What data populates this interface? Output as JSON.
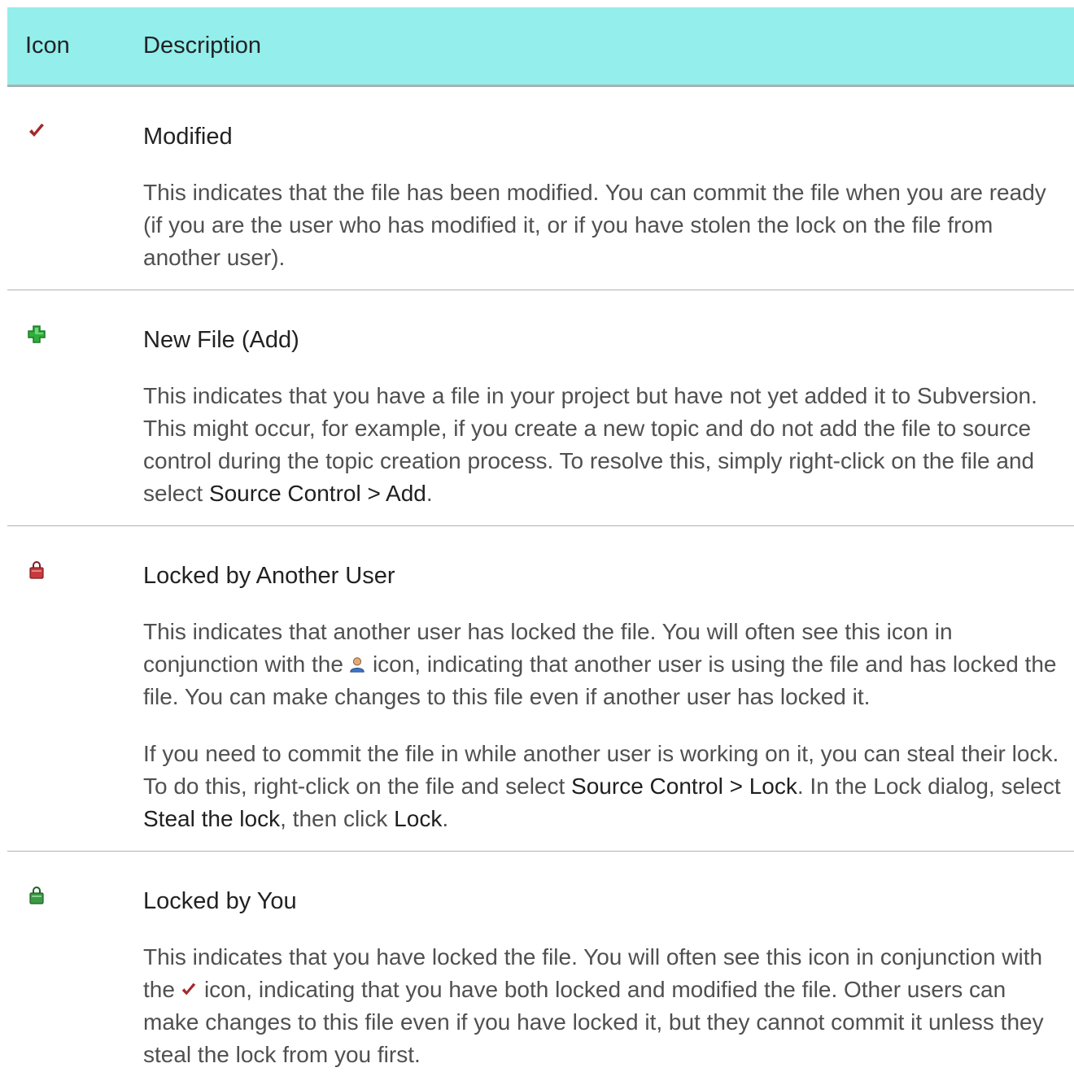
{
  "header": {
    "icon_col": "Icon",
    "desc_col": "Description"
  },
  "rows": [
    {
      "icon": "checkmark-icon",
      "title": "Modified",
      "text": "This indicates that the file has been modified. You can commit the file when you are ready (if you are the user who has modified it, or if you have stolen the lock on the file from another user)."
    },
    {
      "icon": "plus-icon",
      "title": "New File (Add)",
      "text_before": "This indicates that you have a file in your project but have not yet added it to Subversion. This might occur, for example, if you create a new topic and do not add the file to source control during the topic creation process. To resolve this, simply right-click on the file and select ",
      "command": "Source Control > Add",
      "text_after": "."
    },
    {
      "icon": "lock-red-icon",
      "title": "Locked by Another User",
      "p1_before": "This indicates that another user has locked the file. You will often see this icon in conjunction with the",
      "p1_after": "icon, indicating that another user is using the file and has locked the file. You can make changes to this file even if another user has locked it.",
      "p2_a": "If you need to commit the file in while another user is working on it, you can steal their lock. To do this, right-click on the file and select ",
      "p2_cmd1": "Source Control > Lock",
      "p2_b": ". In the Lock dialog, select ",
      "p2_cmd2": "Steal the lock",
      "p2_c": ", then click ",
      "p2_cmd3": "Lock",
      "p2_d": "."
    },
    {
      "icon": "lock-green-icon",
      "title": "Locked by You",
      "p1_before": "This indicates that you have locked the file. You will often see this icon in conjunction with the",
      "p1_after": "icon, indicating that you have both locked and modified the file. Other users can make changes to this file even if you have locked it, but they cannot commit it unless they steal the lock from you first."
    }
  ]
}
